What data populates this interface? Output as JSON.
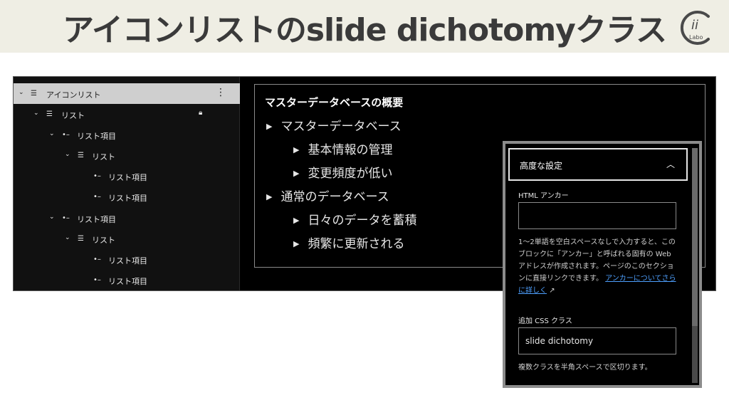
{
  "banner": {
    "title": "アイコンリストのslide dichotomyクラス",
    "logo_text": "ii",
    "logo_sub": "Labo"
  },
  "list_view": {
    "items": [
      {
        "label": "アイコンリスト",
        "icon": "list-icon",
        "chevron": true,
        "lock": false
      },
      {
        "label": "リスト",
        "icon": "list-icon",
        "chevron": true,
        "lock": true
      },
      {
        "label": "リスト項目",
        "icon": "list-item-icon",
        "chevron": true,
        "lock": false
      },
      {
        "label": "リスト",
        "icon": "list-icon",
        "chevron": true,
        "lock": false
      },
      {
        "label": "リスト項目",
        "icon": "list-item-icon",
        "chevron": false,
        "lock": false
      },
      {
        "label": "リスト項目",
        "icon": "list-item-icon",
        "chevron": false,
        "lock": false
      },
      {
        "label": "リスト項目",
        "icon": "list-item-icon",
        "chevron": true,
        "lock": false
      },
      {
        "label": "リスト",
        "icon": "list-icon",
        "chevron": true,
        "lock": false
      },
      {
        "label": "リスト項目",
        "icon": "list-item-icon",
        "chevron": false,
        "lock": false
      },
      {
        "label": "リスト項目",
        "icon": "list-item-icon",
        "chevron": false,
        "lock": false
      }
    ]
  },
  "canvas": {
    "heading": "マスターデータベースの概要",
    "items": [
      {
        "text": "マスターデータベース",
        "level": 1
      },
      {
        "text": "基本情報の管理",
        "level": 2
      },
      {
        "text": "変更頻度が低い",
        "level": 2
      },
      {
        "text": "通常のデータベース",
        "level": 1
      },
      {
        "text": "日々のデータを蓄積",
        "level": 2
      },
      {
        "text": "頻繁に更新される",
        "level": 2
      }
    ]
  },
  "settings_panel": {
    "title": "高度な設定",
    "anchor_label": "HTML アンカー",
    "anchor_value": "",
    "anchor_help": "1〜2単語を空白スペースなしで入力すると、このブロックに「アンカー」と呼ばれる固有の Web アドレスが作成されます。ページのこのセクションに直接リンクできます。",
    "anchor_link": "アンカーについてさらに詳しく",
    "anchor_link_arrow": "↗",
    "css_label": "追加 CSS クラス",
    "css_value": "slide dichotomy",
    "css_help": "複数クラスを半角スペースで区切ります。"
  }
}
